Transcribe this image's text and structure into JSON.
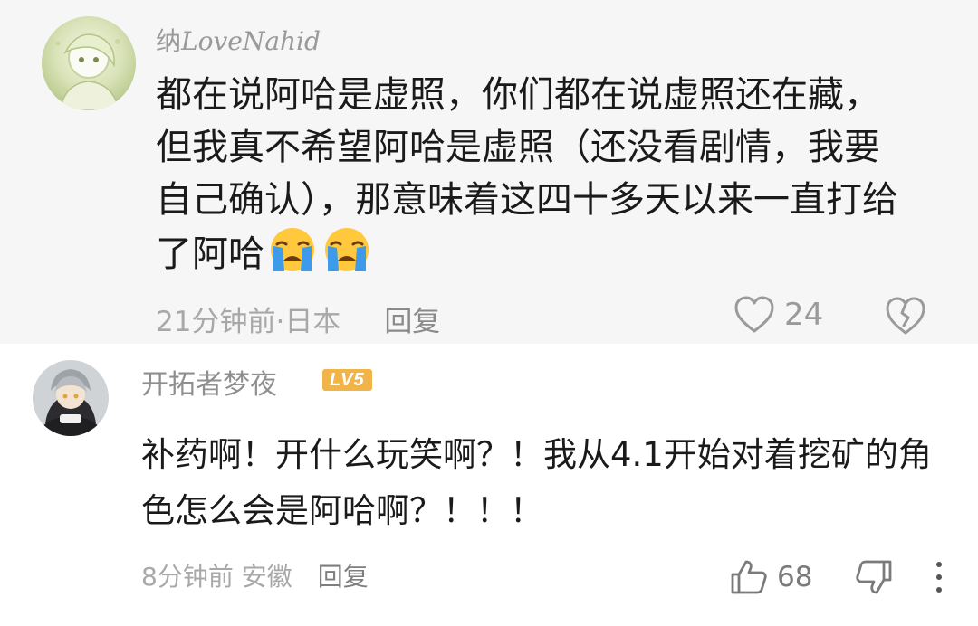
{
  "comments": [
    {
      "username_prefix": "纳",
      "username_script": "LoveNahid",
      "content": "都在说阿哈是虚照，你们都在说虚照还在藏，但我真不希望阿哈是虚照（还没看剧情，我要自己确认），那意味着这四十多天以来一直打给了阿哈",
      "emojis": [
        "loudly-crying-face",
        "loudly-crying-face"
      ],
      "time": "21分钟前",
      "separator": " · ",
      "location": "日本",
      "reply_label": "回复",
      "like_count": "24",
      "like_icon": "heart-icon",
      "dislike_icon": "broken-heart-icon"
    },
    {
      "username": "开拓者梦夜",
      "level_badge": "LV5",
      "content": "补药啊！开什么玩笑啊？！我从4.1开始对着挖矿的角色怎么会是阿哈啊？！！！",
      "time": "8分钟前",
      "location": "安徽",
      "reply_label": "回复",
      "like_count": "68",
      "like_icon": "thumbs-up-icon",
      "dislike_icon": "thumbs-down-icon",
      "more_icon": "more-vertical-icon"
    }
  ],
  "colors": {
    "meta_text": "#a8a8a8",
    "badge": "#f0b449",
    "content_text": "#1a1a1a"
  }
}
